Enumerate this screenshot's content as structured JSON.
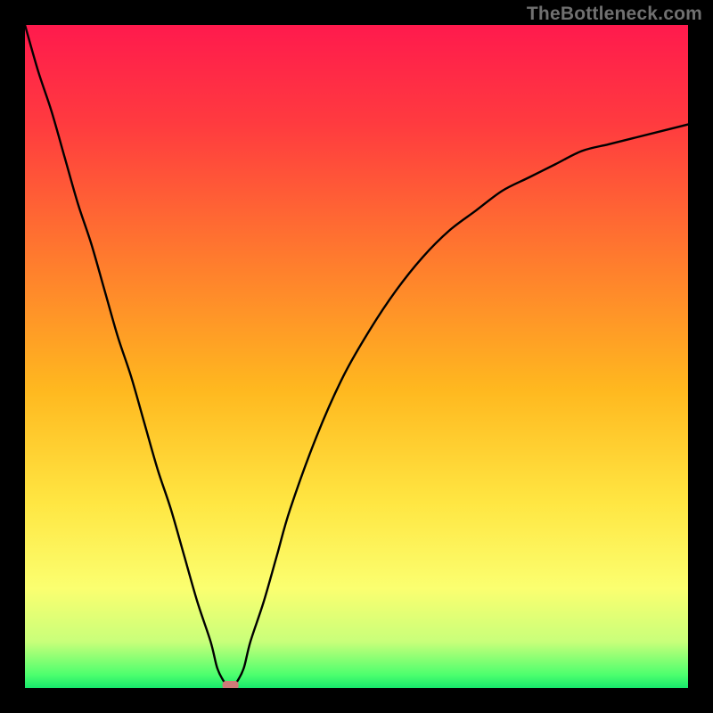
{
  "watermark": "TheBottleneck.com",
  "chart_data": {
    "type": "line",
    "title": "",
    "xlabel": "",
    "ylabel": "",
    "xlim": [
      0,
      100
    ],
    "ylim": [
      0,
      100
    ],
    "grid": false,
    "legend": false,
    "background_gradient": {
      "direction": "vertical",
      "stops": [
        {
          "pos": 0.0,
          "color": "#ff1a4d"
        },
        {
          "pos": 0.15,
          "color": "#ff3b3f"
        },
        {
          "pos": 0.35,
          "color": "#ff7a2e"
        },
        {
          "pos": 0.55,
          "color": "#ffb81f"
        },
        {
          "pos": 0.72,
          "color": "#ffe642"
        },
        {
          "pos": 0.85,
          "color": "#fbff70"
        },
        {
          "pos": 0.93,
          "color": "#c9ff7a"
        },
        {
          "pos": 0.98,
          "color": "#4dff6e"
        },
        {
          "pos": 1.0,
          "color": "#17e86b"
        }
      ]
    },
    "series": [
      {
        "name": "bottleneck-curve",
        "color": "#000000",
        "x": [
          0,
          2,
          4,
          6,
          8,
          10,
          12,
          14,
          16,
          18,
          20,
          22,
          24,
          26,
          28,
          29,
          30,
          31,
          32,
          33,
          34,
          36,
          38,
          40,
          44,
          48,
          52,
          56,
          60,
          64,
          68,
          72,
          76,
          80,
          84,
          88,
          92,
          96,
          100
        ],
        "y": [
          100,
          93,
          87,
          80,
          73,
          67,
          60,
          53,
          47,
          40,
          33,
          27,
          20,
          13,
          7,
          3,
          1,
          0,
          1,
          3,
          7,
          13,
          20,
          27,
          38,
          47,
          54,
          60,
          65,
          69,
          72,
          75,
          77,
          79,
          81,
          82,
          83,
          84,
          85
        ]
      }
    ],
    "annotations": [
      {
        "name": "min-marker",
        "shape": "rounded-rect",
        "x": 31,
        "y": 0,
        "color": "#cf7a78"
      }
    ]
  }
}
